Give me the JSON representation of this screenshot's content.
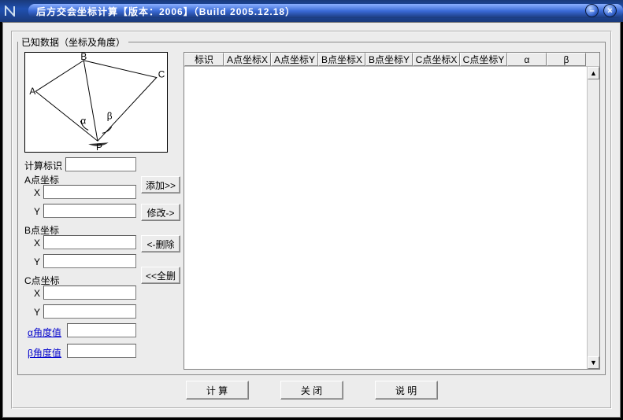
{
  "window": {
    "title": "后方交会坐标计算【版本：2006】（Build 2005.12.18）"
  },
  "group": {
    "legend": "已知数据（坐标及角度）"
  },
  "diagram": {
    "labels": {
      "A": "A",
      "B": "B",
      "C": "C",
      "P": "P",
      "alpha": "α",
      "beta": "β"
    }
  },
  "inputs": {
    "calcId_label": "计算标识",
    "A_label": "A点坐标",
    "B_label": "B点坐标",
    "C_label": "C点坐标",
    "X": "X",
    "Y": "Y",
    "alpha_label": "α角度值",
    "beta_label": "β角度值",
    "calcId": "",
    "A_X": "",
    "A_Y": "",
    "B_X": "",
    "B_Y": "",
    "C_X": "",
    "C_Y": "",
    "alpha": "",
    "beta": ""
  },
  "buttons": {
    "add": "添加>>",
    "modify": "修改->",
    "delete": "<-删除",
    "clear": "<<全删",
    "compute": "计 算",
    "close": "关 闭",
    "help": "说 明"
  },
  "grid": {
    "columns": [
      "标识",
      "A点坐标X",
      "A点坐标Y",
      "B点坐标X",
      "B点坐标Y",
      "C点坐标X",
      "C点坐标Y",
      "α",
      "β"
    ],
    "rows": []
  }
}
